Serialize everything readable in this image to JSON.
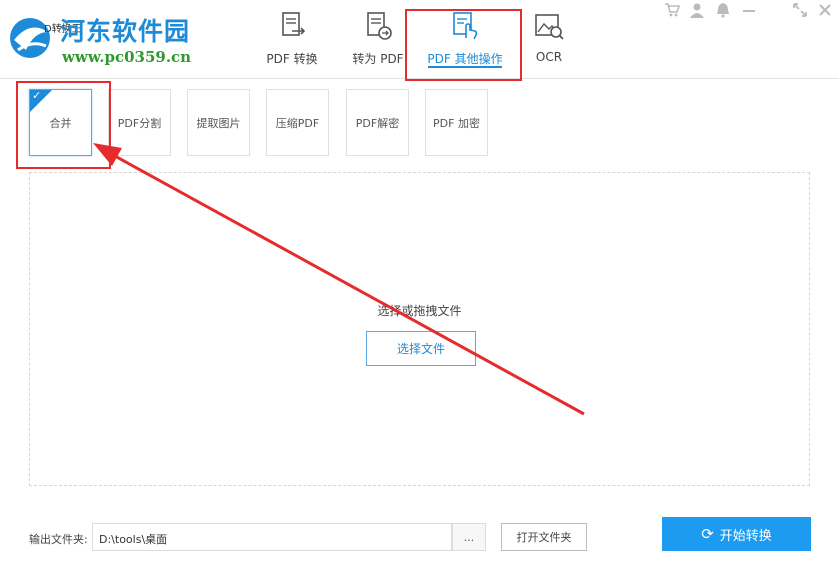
{
  "logo": {
    "title": "河东软件园",
    "url": "www.pc0359.cn",
    "app_name_partial": "D转换王"
  },
  "nav_tabs": [
    {
      "label": "PDF 转换",
      "icon": "document-convert-icon"
    },
    {
      "label": "转为 PDF",
      "icon": "document-to-pdf-icon"
    },
    {
      "label": "PDF 其他操作",
      "icon": "document-touch-icon"
    },
    {
      "label": "OCR",
      "icon": "image-search-icon"
    }
  ],
  "window_controls": [
    "cart-icon",
    "user-icon",
    "bell-icon",
    "minimize-icon",
    "restore-icon",
    "close-icon"
  ],
  "operations": [
    "合并",
    "PDF分割",
    "提取图片",
    "压缩PDF",
    "PDF解密",
    "PDF 加密"
  ],
  "dropzone": {
    "hint": "选择或拖拽文件",
    "select_label": "选择文件"
  },
  "footer": {
    "output_label": "输出文件夹:",
    "output_path": "D:\\tools\\桌面",
    "browse_label": "...",
    "open_folder_label": "打开文件夹",
    "start_label": "开始转换"
  },
  "colors": {
    "accent": "#1d8bd8",
    "highlight": "#e52b2b",
    "start_button": "#1d9bf0"
  }
}
